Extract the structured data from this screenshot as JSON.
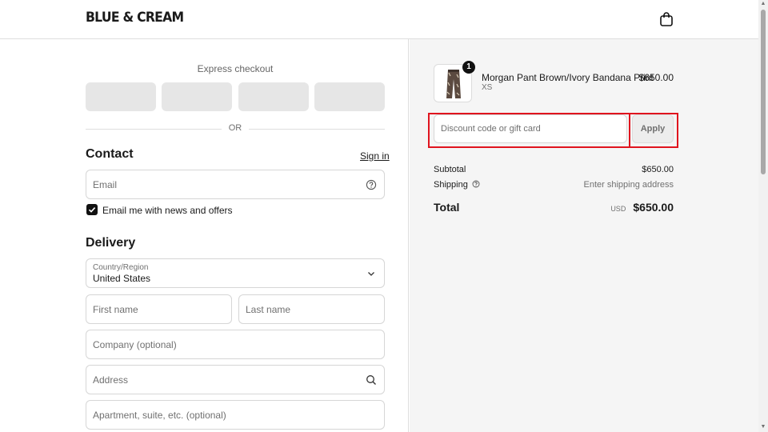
{
  "header": {
    "logo": "BLUE & CREAM",
    "cart_icon": "shopping-bag-icon"
  },
  "left": {
    "express_label": "Express checkout",
    "or_text": "OR",
    "contact": {
      "title": "Contact",
      "sign_in": "Sign in",
      "email_placeholder": "Email",
      "newsletter_label": "Email me with news and offers",
      "newsletter_checked": true
    },
    "delivery": {
      "title": "Delivery",
      "country_label": "Country/Region",
      "country_value": "United States",
      "first_name": "First name",
      "last_name": "Last name",
      "company": "Company (optional)",
      "address": "Address",
      "apartment": "Apartment, suite, etc. (optional)"
    }
  },
  "summary": {
    "item": {
      "name": "Morgan Pant Brown/Ivory Bandana Print",
      "variant": "XS",
      "price": "$650.00",
      "quantity": "1"
    },
    "discount_placeholder": "Discount code or gift card",
    "apply_label": "Apply",
    "subtotal_label": "Subtotal",
    "subtotal_value": "$650.00",
    "shipping_label": "Shipping",
    "shipping_value": "Enter shipping address",
    "total_label": "Total",
    "total_currency": "USD",
    "total_value": "$650.00"
  },
  "colors": {
    "highlight": "#e0141e",
    "accent": "#111111"
  }
}
